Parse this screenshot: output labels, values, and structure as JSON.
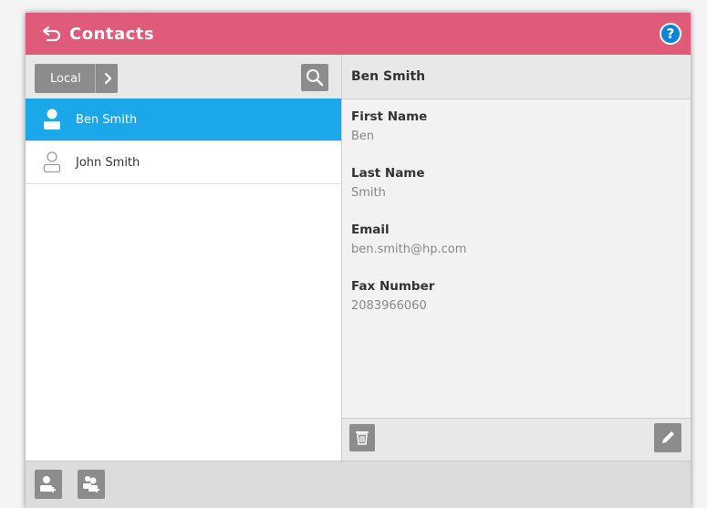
{
  "header": {
    "title": "Contacts"
  },
  "colors": {
    "header_bg": "#e05a7a",
    "selected_row": "#1aa8ea",
    "help": "#0a84d8",
    "button_gray": "#8c8c8c"
  },
  "left": {
    "source_label": "Local",
    "contacts": [
      {
        "name": "Ben Smith",
        "selected": true
      },
      {
        "name": "John Smith",
        "selected": false
      }
    ]
  },
  "detail": {
    "name": "Ben Smith",
    "fields": [
      {
        "label": "First Name",
        "value": "Ben"
      },
      {
        "label": "Last Name",
        "value": "Smith"
      },
      {
        "label": "Email",
        "value": "ben.smith@hp.com"
      },
      {
        "label": "Fax Number",
        "value": "2083966060"
      }
    ]
  },
  "icons": {
    "back": "back-arrow-icon",
    "help": "help-icon",
    "search": "search-icon",
    "trash": "trash-icon",
    "edit": "pencil-icon",
    "add_contact": "add-contact-icon",
    "add_group": "add-group-icon"
  }
}
